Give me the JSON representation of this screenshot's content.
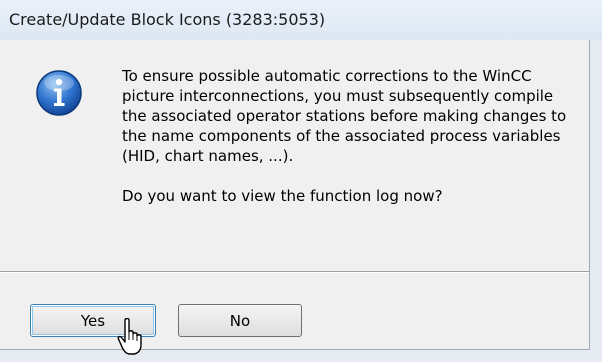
{
  "window": {
    "title": "Create/Update Block Icons  (3283:5053)"
  },
  "dialog": {
    "icon": "information-icon",
    "message": "To ensure possible automatic corrections to the WinCC picture interconnections, you must subsequently compile the associated operator stations before making changes to the name components of the associated process variables (HID, chart names, ...).",
    "question": "Do you want to view the function log now?"
  },
  "buttons": {
    "yes_label": "Yes",
    "no_label": "No"
  },
  "colors": {
    "title_bar": "#dde7f3",
    "dialog_background": "#f0f0f0",
    "icon_blue": "#1f5fb4",
    "default_button_border": "#3c7fb1"
  }
}
